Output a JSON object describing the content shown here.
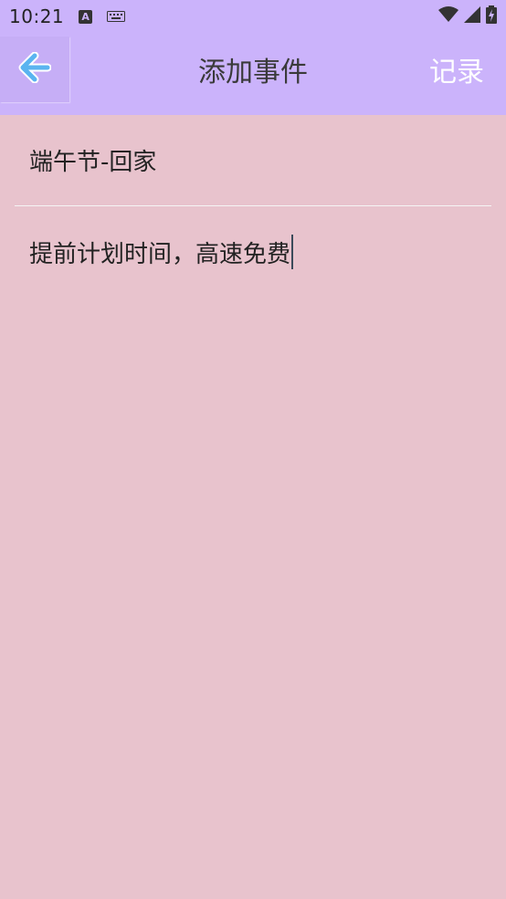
{
  "status_bar": {
    "time": "10:21",
    "notification_a": "A"
  },
  "app_bar": {
    "title": "添加事件",
    "record_label": "记录"
  },
  "form": {
    "title_value": "端午节-回家",
    "body_value": "提前计划时间，高速免费"
  },
  "colors": {
    "app_bar": "#cbb3fb",
    "background": "#e8c3cd",
    "back_arrow": "#5ab4f0"
  },
  "icons": {
    "back": "arrow-left-icon",
    "wifi": "wifi-icon",
    "signal": "signal-icon",
    "battery": "battery-icon",
    "keyboard": "keyboard-icon"
  }
}
